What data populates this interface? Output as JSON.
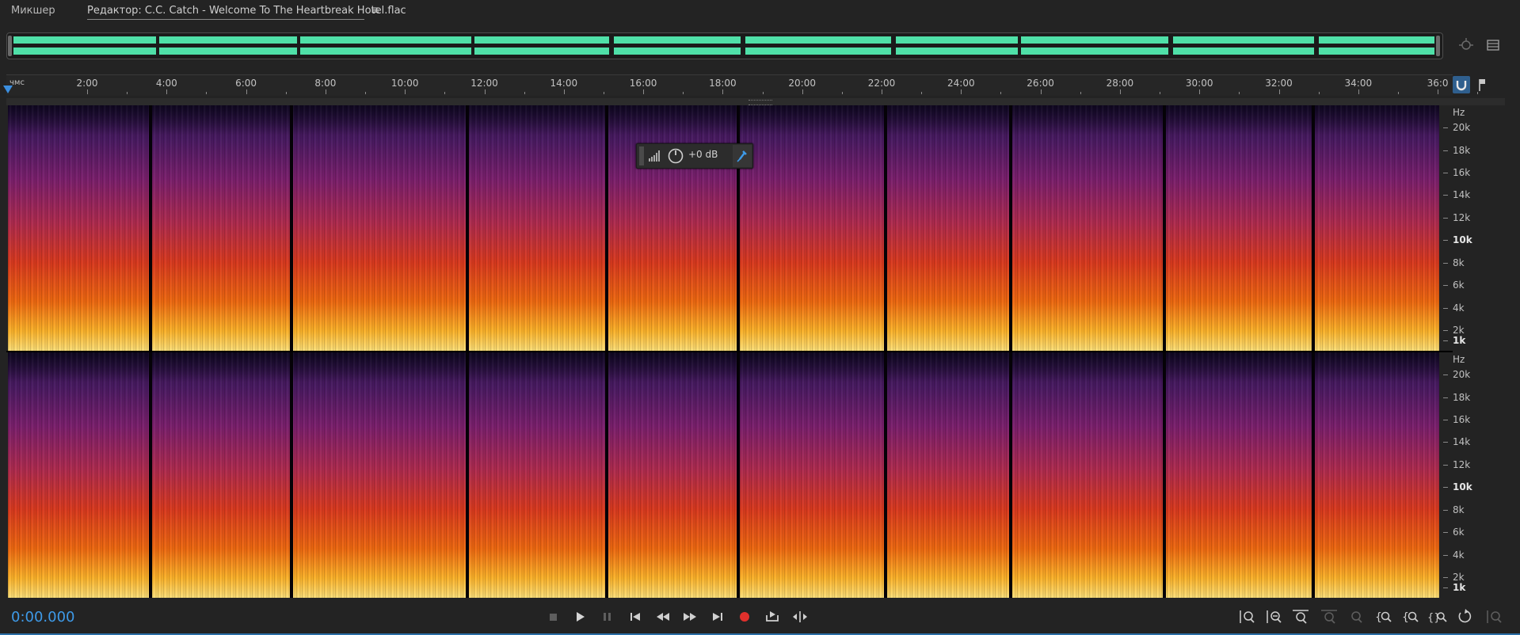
{
  "tabs": {
    "mixer_label": "Микшер",
    "editor_label": "Редактор: C.C. Catch - Welcome To The Heartbreak Hotel.flac",
    "menu_glyph": "≡"
  },
  "ruler": {
    "unit": "чмс",
    "labels": [
      "2:00",
      "4:00",
      "6:00",
      "8:00",
      "10:00",
      "12:00",
      "14:00",
      "16:00",
      "18:00",
      "20:00",
      "22:00",
      "24:00",
      "26:00",
      "28:00",
      "30:00",
      "32:00",
      "34:00",
      "36:0"
    ]
  },
  "hz_scale": {
    "unit": "Hz",
    "labels": [
      "20k",
      "18k",
      "16k",
      "14k",
      "12k",
      "10k",
      "8k",
      "6k",
      "4k",
      "2k",
      "1k"
    ]
  },
  "hud": {
    "value": "+0 dB"
  },
  "transport": {
    "timecode": "0:00.000"
  },
  "colors": {
    "accent": "#3e9ae8",
    "waveform": "#4fe0a8",
    "record": "#e0302c"
  },
  "icons": {
    "stop": "stop-icon",
    "play": "play-icon",
    "pause": "pause-icon",
    "to_start": "skip-to-start-icon",
    "rewind": "rewind-icon",
    "fast_forward": "fast-forward-icon",
    "to_end": "skip-to-end-icon",
    "record": "record-icon",
    "loop": "loop-icon",
    "skip": "skip-selection-icon"
  }
}
